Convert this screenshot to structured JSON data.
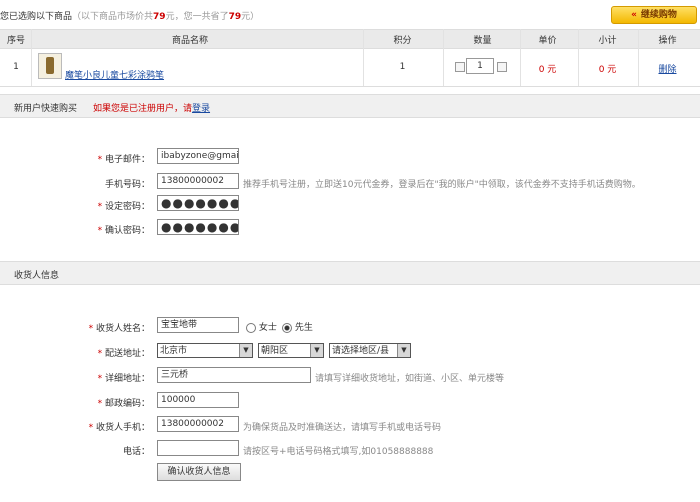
{
  "top": {
    "title_prefix": "您已选购以下商品",
    "title_note_1": "（以下商品市场价共",
    "market_total": "79",
    "title_note_2": "元，您一共省了",
    "saved": "79",
    "title_note_3": "元）",
    "continue_button": "继续购物",
    "continue_chevron": "«"
  },
  "cart": {
    "columns": [
      "序号",
      "商品名称",
      "积分",
      "数量",
      "单价",
      "小计",
      "操作"
    ],
    "items": [
      {
        "index": "1",
        "name": "魔笔小良儿童七彩涂鸦笔",
        "points": "1",
        "qty": "1",
        "unit_price": "0 元",
        "subtotal": "0 元",
        "action": "删除"
      }
    ]
  },
  "quick_buy": {
    "heading": "新用户快速购买",
    "note": "如果您是已注册用户，请",
    "login_link": "登录",
    "fields": {
      "email": {
        "label": "电子邮件：",
        "value": "ibabyzone@gmail.co"
      },
      "phone": {
        "label": "手机号码：",
        "value": "13800000002",
        "hint": "推荐手机号注册，立即送10元代金券，登录后在\"我的账户\"中领取，该代金券不支持手机话费购物。"
      },
      "password": {
        "label": "设定密码：",
        "value": "●●●●●●●"
      },
      "confirm": {
        "label": "确认密码：",
        "value": "●●●●●●●"
      }
    }
  },
  "receiver": {
    "heading": "收货人信息",
    "name": {
      "label": "收货人姓名：",
      "value": "宝宝地带",
      "female": "女士",
      "male": "先生"
    },
    "region": {
      "label": "配送地址：",
      "province": "北京市",
      "district": "朝阳区",
      "area": "请选择地区/县"
    },
    "address": {
      "label": "详细地址：",
      "value": "三元桥",
      "hint": "请填写详细收货地址，如街道、小区、单元楼等"
    },
    "zip": {
      "label": "邮政编码：",
      "value": "100000"
    },
    "mobile": {
      "label": "收货人手机：",
      "value": "13800000002",
      "hint": "为确保货品及时准确送达，请填写手机或电话号码"
    },
    "tel": {
      "label": "电话：",
      "value": "",
      "hint": "请按区号+电话号码格式填写,如01058888888"
    },
    "confirm_button": "确认收货人信息"
  },
  "colors": {
    "accent_red": "#cc0000",
    "link_blue": "#1a4aa0",
    "button_yellow": "#f3b800"
  },
  "icons": {
    "product_thumb": "product-thumbnail",
    "continue": "double-chevron-left-icon"
  }
}
